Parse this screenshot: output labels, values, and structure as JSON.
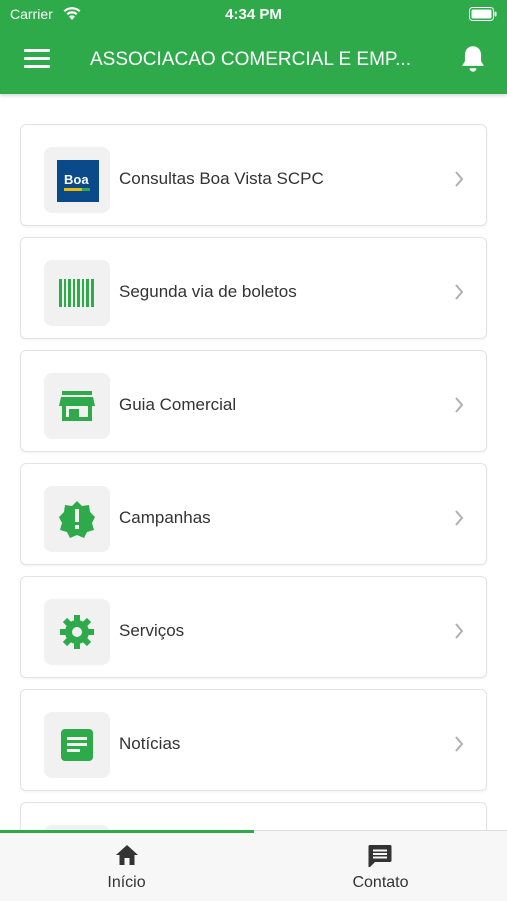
{
  "status_bar": {
    "carrier": "Carrier",
    "time": "4:34 PM"
  },
  "app_bar": {
    "title": "ASSOCIACAO COMERCIAL E EMP..."
  },
  "menu": {
    "items": [
      {
        "label": "Consultas Boa Vista SCPC",
        "icon": "boa-vista-logo",
        "logo_text": "Boa"
      },
      {
        "label": "Segunda via de boletos",
        "icon": "barcode-icon"
      },
      {
        "label": "Guia Comercial",
        "icon": "store-icon"
      },
      {
        "label": "Campanhas",
        "icon": "alert-badge-icon"
      },
      {
        "label": "Serviços",
        "icon": "gear-icon"
      },
      {
        "label": "Notícias",
        "icon": "article-icon"
      }
    ]
  },
  "tab_bar": {
    "tabs": [
      {
        "label": "Início",
        "icon": "home-icon",
        "active": true
      },
      {
        "label": "Contato",
        "icon": "chat-icon",
        "active": false
      }
    ]
  },
  "colors": {
    "accent": "#2eaa4b",
    "logo_blue": "#0a4a8a",
    "text": "#333333"
  }
}
